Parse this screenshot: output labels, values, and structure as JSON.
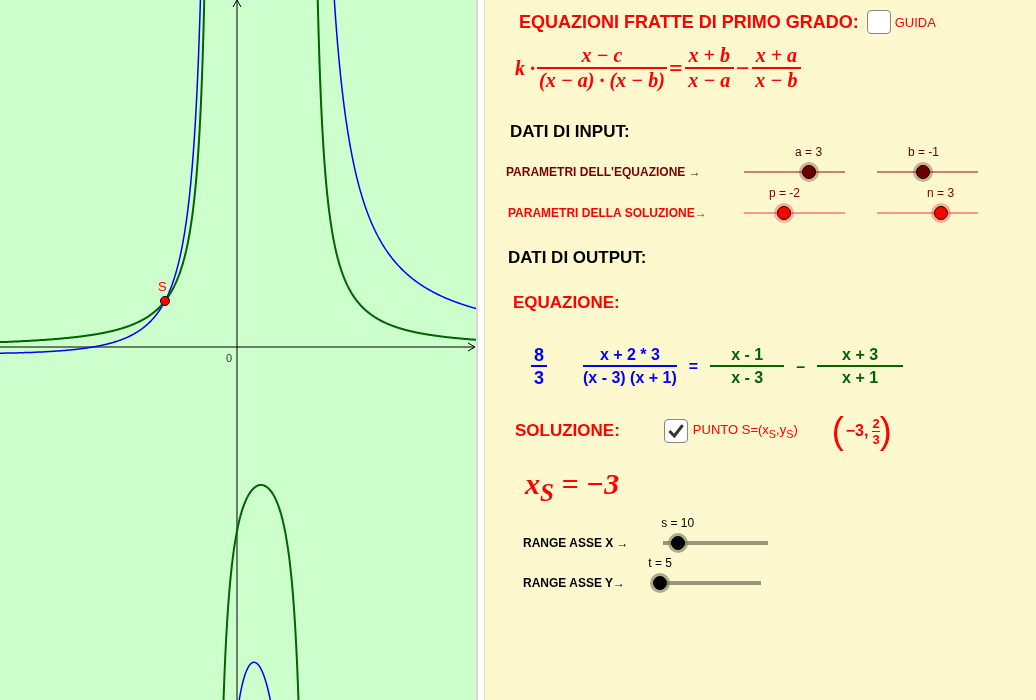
{
  "graph": {
    "origin_label": "0",
    "point_label": "S"
  },
  "title": "EQUAZIONI FRATTE DI PRIMO GRADO:",
  "guide": {
    "label": "GUIDA",
    "checked": false
  },
  "formula": {
    "factor": "k ·",
    "terms": [
      {
        "kind": "fraction",
        "num": "x − c",
        "den": "(x − a) · (x − b)"
      },
      {
        "kind": "op",
        "text": "="
      },
      {
        "kind": "fraction",
        "num": "x + b",
        "den": "x − a"
      },
      {
        "kind": "op",
        "text": "−"
      },
      {
        "kind": "fraction",
        "num": "x + a",
        "den": "x − b"
      }
    ]
  },
  "input_heading": "DATI DI INPUT:",
  "parameter_rows": [
    {
      "label": "PARAMETRI DELL'EQUAZIONE →",
      "kind": "equation",
      "sliders": [
        {
          "value": "a = 3",
          "level": 0.64
        },
        {
          "value": "b = -1",
          "level": 0.46
        }
      ]
    },
    {
      "label": "PARAMETRI DELLA SOLUZIONE→",
      "kind": "solution",
      "sliders": [
        {
          "value": "p = -2",
          "level": 0.4
        },
        {
          "value": "n = 3",
          "level": 0.63
        }
      ]
    }
  ],
  "output_heading": "DATI DI OUTPUT:",
  "equation_heading": "EQUAZIONE:",
  "equation": [
    {
      "kind": "fraction",
      "color": "#0000ff",
      "num": "8",
      "den": "3"
    },
    {
      "kind": "fraction",
      "color": "#0000ff",
      "num": "x + 2 * 3",
      "den": "(x - 3) (x + 1)"
    },
    {
      "kind": "op",
      "color": "#0000ff",
      "text": "="
    },
    {
      "kind": "fraction",
      "color": "#006400",
      "num": "x - 1",
      "den": "x - 3"
    },
    {
      "kind": "op",
      "color": "#006400",
      "text": "–"
    },
    {
      "kind": "fraction",
      "color": "#006400",
      "num": "x + 3",
      "den": "x + 1"
    }
  ],
  "solution": {
    "heading": "SOLUZIONE:",
    "checked": true,
    "checkbox_label": "PUNTO S=(x$_{S}$,y$_{S}$)",
    "point_open": "(",
    "point_x": "−3,",
    "point_y_num": "2",
    "point_y_den": "3",
    "point_close": ")"
  },
  "result": "x$_{S}$ = −3",
  "range_rows": [
    {
      "label": "RANGE ASSE X →",
      "value": "s = 10",
      "level": 0.14
    },
    {
      "label": "RANGE ASSE Y→",
      "value": "t = 5",
      "level": 0.04
    }
  ]
}
